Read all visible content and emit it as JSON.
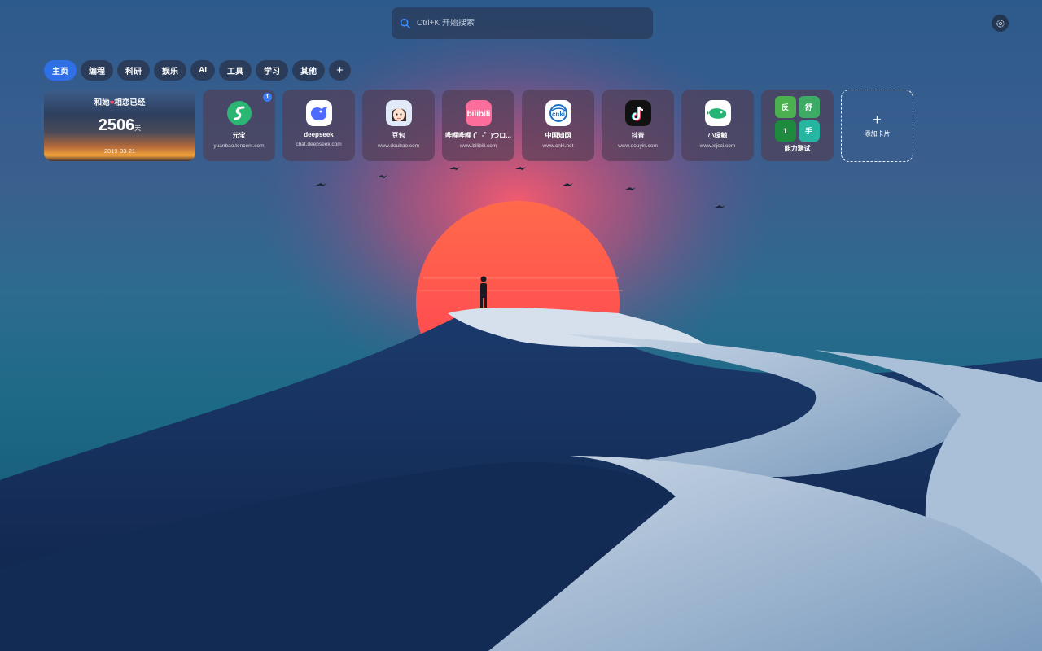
{
  "search": {
    "placeholder": "Ctrl+K 开始搜索"
  },
  "tabs": [
    "主页",
    "编程",
    "科研",
    "娱乐",
    "AI",
    "工具",
    "学习",
    "其他"
  ],
  "tabs_add": "+",
  "love": {
    "title_before": "和她",
    "title_after": "相恋已经",
    "days": "2506",
    "days_unit": "天",
    "date": "2019-03-21"
  },
  "cards": [
    {
      "name": "元宝",
      "url": "yuanbao.tencent.com",
      "badge": "1",
      "icon": "yuanbao-icon"
    },
    {
      "name": "deepseek",
      "url": "chat.deepseek.com",
      "icon": "deepseek-icon"
    },
    {
      "name": "豆包",
      "url": "www.doubao.com",
      "icon": "doubao-icon"
    },
    {
      "name": "哔哩哔哩 (゜-゜)つロ...",
      "url": "www.bilibili.com",
      "icon": "bilibili-icon"
    },
    {
      "name": "中国知网",
      "url": "www.cnki.net",
      "icon": "cnki-icon"
    },
    {
      "name": "抖音",
      "url": "www.douyin.com",
      "icon": "douyin-icon"
    },
    {
      "name": "小绿鲸",
      "url": "www.xljsci.com",
      "icon": "xiaolvjing-icon"
    }
  ],
  "ability": {
    "name": "能力测试",
    "tiles": [
      "反",
      "舒",
      "1",
      "手"
    ]
  },
  "add_card": {
    "plus": "+",
    "label": "添加卡片"
  },
  "colors": {
    "accent": "#2f6fe7",
    "badge": "#3a7bf2",
    "heart": "#ff4d6a"
  }
}
